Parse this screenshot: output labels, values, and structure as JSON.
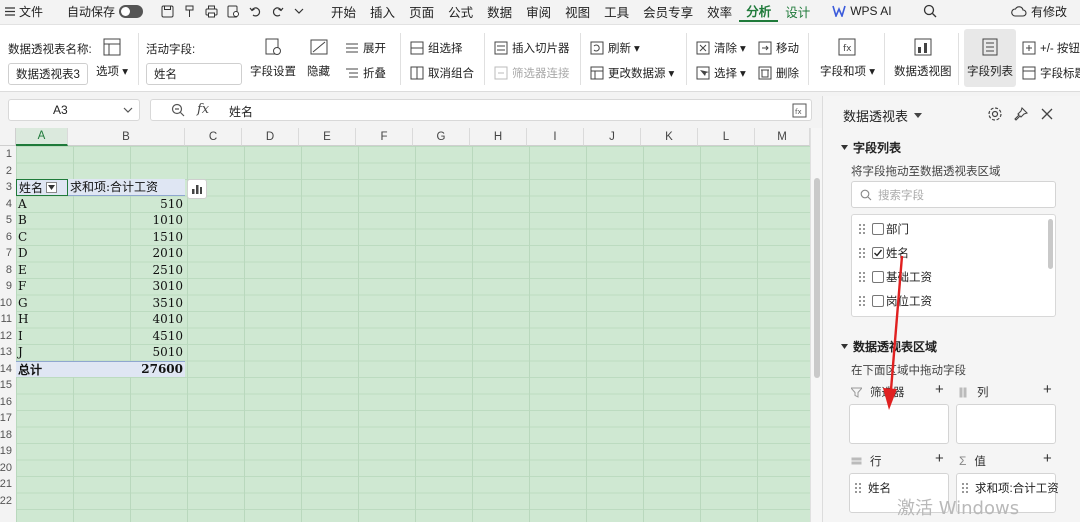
{
  "menubar": {
    "file": "文件",
    "autosave": "自动保存",
    "tabs": [
      "开始",
      "插入",
      "页面",
      "公式",
      "数据",
      "审阅",
      "视图",
      "工具",
      "会员专享",
      "效率"
    ],
    "active_tab": "分析",
    "design_tab": "设计",
    "wps_ai": "WPS AI",
    "edit_status": "有修改"
  },
  "ribbon": {
    "pivot_name_label": "数据透视表名称:",
    "pivot_name_value": "数据透视表3",
    "options": "选项",
    "active_field_label": "活动字段:",
    "active_field_value": "姓名",
    "field_settings": "字段设置",
    "hide": "隐藏",
    "expand": "展开",
    "collapse": "折叠",
    "group_select": "组选择",
    "ungroup": "取消组合",
    "insert_slicer": "插入切片器",
    "filter_connections": "筛选器连接",
    "refresh": "刷新",
    "change_source": "更改数据源",
    "clear": "清除",
    "select": "选择",
    "move": "移动",
    "delete": "删除",
    "fields_items": "字段和项",
    "pivot_chart": "数据透视图",
    "field_list": "字段列表",
    "buttons": "+/- 按钮",
    "field_headers": "字段标题"
  },
  "formula_bar": {
    "cell_ref": "A3",
    "formula": "姓名"
  },
  "sheet": {
    "columns": [
      "A",
      "B",
      "C",
      "D",
      "E",
      "F",
      "G",
      "H",
      "I",
      "J",
      "K",
      "L",
      "M"
    ],
    "row_numbers": [
      "1",
      "2",
      "3",
      "4",
      "5",
      "6",
      "7",
      "8",
      "9",
      "10",
      "11",
      "12",
      "13",
      "14",
      "15",
      "16",
      "17",
      "18",
      "19",
      "20",
      "21",
      "22"
    ],
    "pivot": {
      "header_name": "姓名",
      "header_value": "求和项:合计工资",
      "rows": [
        {
          "name": "A",
          "value": "510"
        },
        {
          "name": "B",
          "value": "1010"
        },
        {
          "name": "C",
          "value": "1510"
        },
        {
          "name": "D",
          "value": "2010"
        },
        {
          "name": "E",
          "value": "2510"
        },
        {
          "name": "F",
          "value": "3010"
        },
        {
          "name": "G",
          "value": "3510"
        },
        {
          "name": "H",
          "value": "4010"
        },
        {
          "name": "I",
          "value": "4510"
        },
        {
          "name": "J",
          "value": "5010"
        }
      ],
      "total_label": "总计",
      "total_value": "27600"
    }
  },
  "pane": {
    "title": "数据透视表",
    "field_list_title": "字段列表",
    "field_list_hint": "将字段拖动至数据透视表区域",
    "search_placeholder": "搜索字段",
    "fields": [
      {
        "label": "部门",
        "checked": false
      },
      {
        "label": "姓名",
        "checked": true
      },
      {
        "label": "基础工资",
        "checked": false
      },
      {
        "label": "岗位工资",
        "checked": false
      }
    ],
    "areas_title": "数据透视表区域",
    "areas_hint": "在下面区域中拖动字段",
    "filter_label": "筛选器",
    "column_label": "列",
    "row_label": "行",
    "value_label": "值",
    "row_chip": "姓名",
    "value_chip": "求和项:合计工资",
    "watermark": "激活 Windows"
  },
  "colors": {
    "accent_green": "#1f7a3a",
    "grid_fill": "#cfe8d2",
    "pivot_header": "#dfe6f3",
    "arrow_red": "#e02020"
  }
}
